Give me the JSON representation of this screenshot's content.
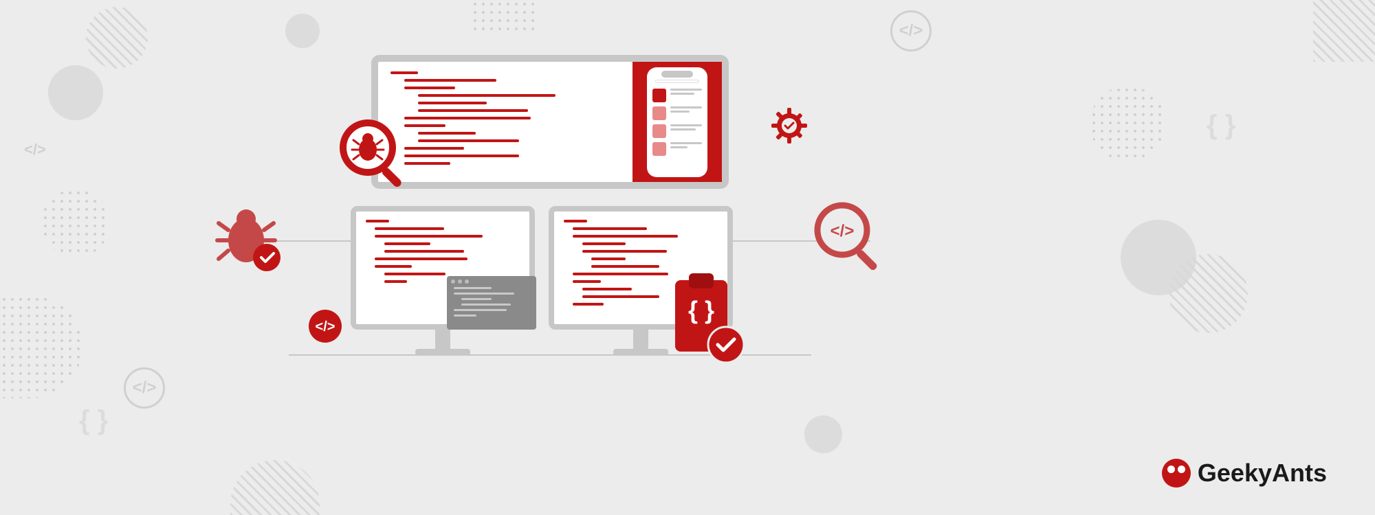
{
  "brand": {
    "name": "GeekyAnts"
  },
  "colors": {
    "accent": "#c11515",
    "bg": "#ececec",
    "neutral": "#c7c7c7"
  },
  "illustration": {
    "theme": "code-review-debugging",
    "screens": [
      "large-monitor-with-phone-preview",
      "small-monitor-left-with-terminal",
      "small-monitor-right"
    ],
    "icons": [
      "bug-with-check",
      "magnifier-bug",
      "gear-check",
      "magnifier-code",
      "code-circle",
      "clipboard-code-check"
    ]
  }
}
